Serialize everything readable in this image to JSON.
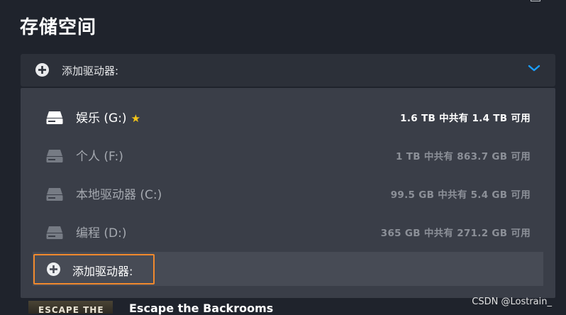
{
  "page": {
    "title": "存储空间"
  },
  "dropdown": {
    "selected_label": "添加驱动器:",
    "expand_icon": "chevron-down-icon",
    "accent_color": "#1a9fff"
  },
  "drives": [
    {
      "name": "娱乐 (G:)",
      "favorite": true,
      "size_text": "1.6 TB 中共有 1.4 TB 可用",
      "state": "active"
    },
    {
      "name": "个人 (F:)",
      "favorite": false,
      "size_text": "1 TB 中共有 863.7 GB 可用",
      "state": "inactive"
    },
    {
      "name": "本地驱动器 (C:)",
      "favorite": false,
      "size_text": "99.5 GB 中共有 5.4 GB 可用",
      "state": "inactive"
    },
    {
      "name": "编程 (D:)",
      "favorite": false,
      "size_text": "365 GB 中共有 271.2 GB 可用",
      "state": "inactive"
    }
  ],
  "add_drive_option": {
    "label": "添加驱动器:",
    "focus_color": "#f0892d"
  },
  "game_strip": {
    "thumb_text": "ESCAPE THE",
    "title": "Escape the Backrooms"
  },
  "watermark": "CSDN @Lostrain_"
}
